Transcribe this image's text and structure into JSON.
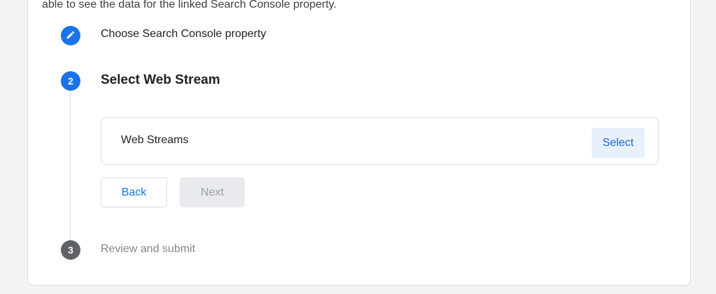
{
  "intro_text": "able to see the data for the linked Search Console property.",
  "steps": [
    {
      "number": "",
      "icon": "pencil-icon",
      "title": "Choose Search Console property",
      "state": "completed"
    },
    {
      "number": "2",
      "title": "Select Web Stream",
      "state": "active"
    },
    {
      "number": "3",
      "title": "Review and submit",
      "state": "pending"
    }
  ],
  "web_streams": {
    "label": "Web Streams",
    "select_label": "Select"
  },
  "actions": {
    "back_label": "Back",
    "next_label": "Next"
  },
  "colors": {
    "accent": "#1a73e8",
    "pending_step": "#5f6368",
    "select_bg": "#e8f0fe",
    "disabled_bg": "#e8eaed"
  }
}
